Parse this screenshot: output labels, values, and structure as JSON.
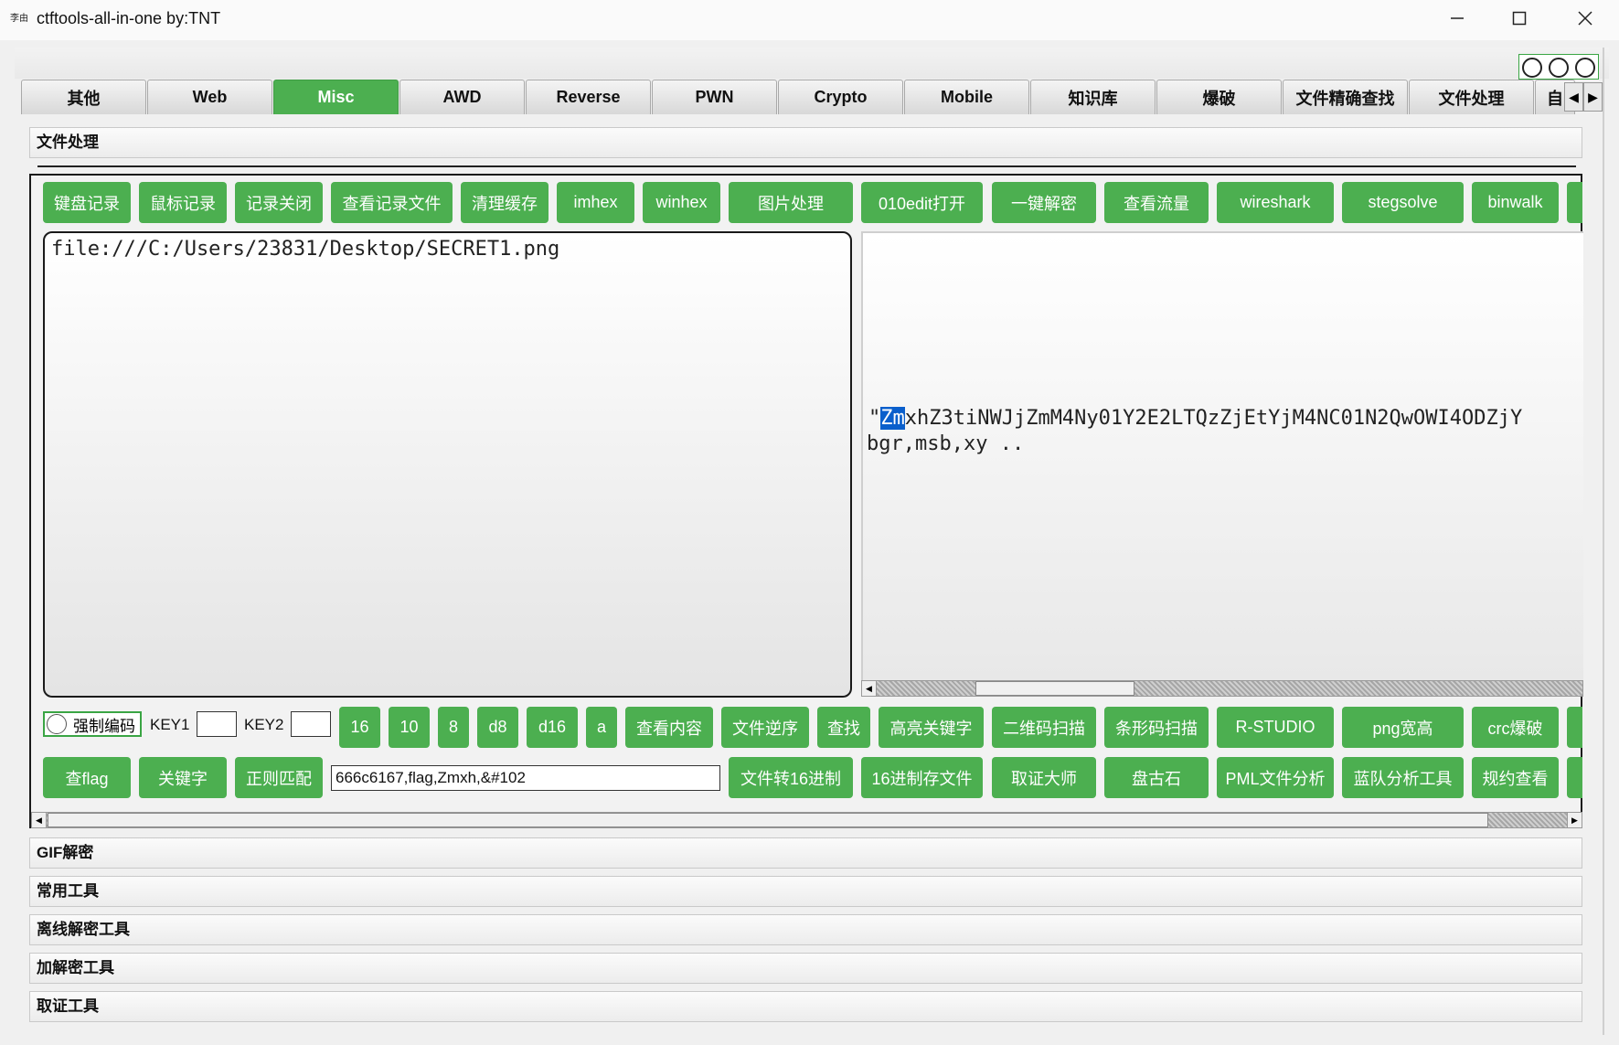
{
  "window": {
    "icon_text": "李由",
    "title": "ctftools-all-in-one    by:TNT"
  },
  "tabs": [
    {
      "label": "其他",
      "active": false
    },
    {
      "label": "Web",
      "active": false
    },
    {
      "label": "Misc",
      "active": true
    },
    {
      "label": "AWD",
      "active": false
    },
    {
      "label": "Reverse",
      "active": false
    },
    {
      "label": "PWN",
      "active": false
    },
    {
      "label": "Crypto",
      "active": false
    },
    {
      "label": "Mobile",
      "active": false
    },
    {
      "label": "知识库",
      "active": false
    },
    {
      "label": "爆破",
      "active": false
    },
    {
      "label": "文件精确查找",
      "active": false
    },
    {
      "label": "文件处理",
      "active": false
    },
    {
      "label": "自",
      "active": false
    }
  ],
  "sections": {
    "file_processing": "文件处理",
    "gif": "GIF解密",
    "common_tools": "常用工具",
    "offline_decrypt": "离线解密工具",
    "crypto_tools": "加解密工具",
    "forensics": "取证工具"
  },
  "row1_buttons": [
    "键盘记录",
    "鼠标记录",
    "记录关闭",
    "查看记录文件",
    "清理缓存",
    "imhex",
    "winhex",
    "图片处理",
    "010edit打开",
    "一键解密",
    "查看流量",
    "wireshark",
    "stegsolve",
    "binwalk"
  ],
  "left_text": "file:///C:/Users/23831/Desktop/SECRET1.png",
  "right_text": {
    "line1_prefix": "\"",
    "line1_highlight": "Zm",
    "line1_rest": "xhZ3tiNWJjZmM4Ny01Y2E2LTQzZjEtYjM4NC01N2QwOWI4ODZjY",
    "line2": "bgr,msb,xy .."
  },
  "row2": {
    "checkbox_label": "强制编码",
    "key1_label": "KEY1",
    "key2_label": "KEY2",
    "buttons": [
      "16",
      "10",
      "8",
      "d8",
      "d16",
      "a",
      "查看内容",
      "文件逆序",
      "查找",
      "高亮关键字",
      "二维码扫描",
      "条形码扫描",
      "R-STUDIO",
      "png宽高",
      "crc爆破"
    ]
  },
  "row3": {
    "buttons_left": [
      "查flag",
      "关键字",
      "正则匹配"
    ],
    "search_value": "666c6167,flag,Zmxh,&#102",
    "buttons_right": [
      "文件转16进制",
      "16进制存文件",
      "取证大师",
      "盘古石",
      "PML文件分析",
      "蓝队分析工具",
      "规约查看"
    ]
  },
  "colors": {
    "accent_green": "#4caf50",
    "highlight_blue": "#0a5fcc"
  }
}
